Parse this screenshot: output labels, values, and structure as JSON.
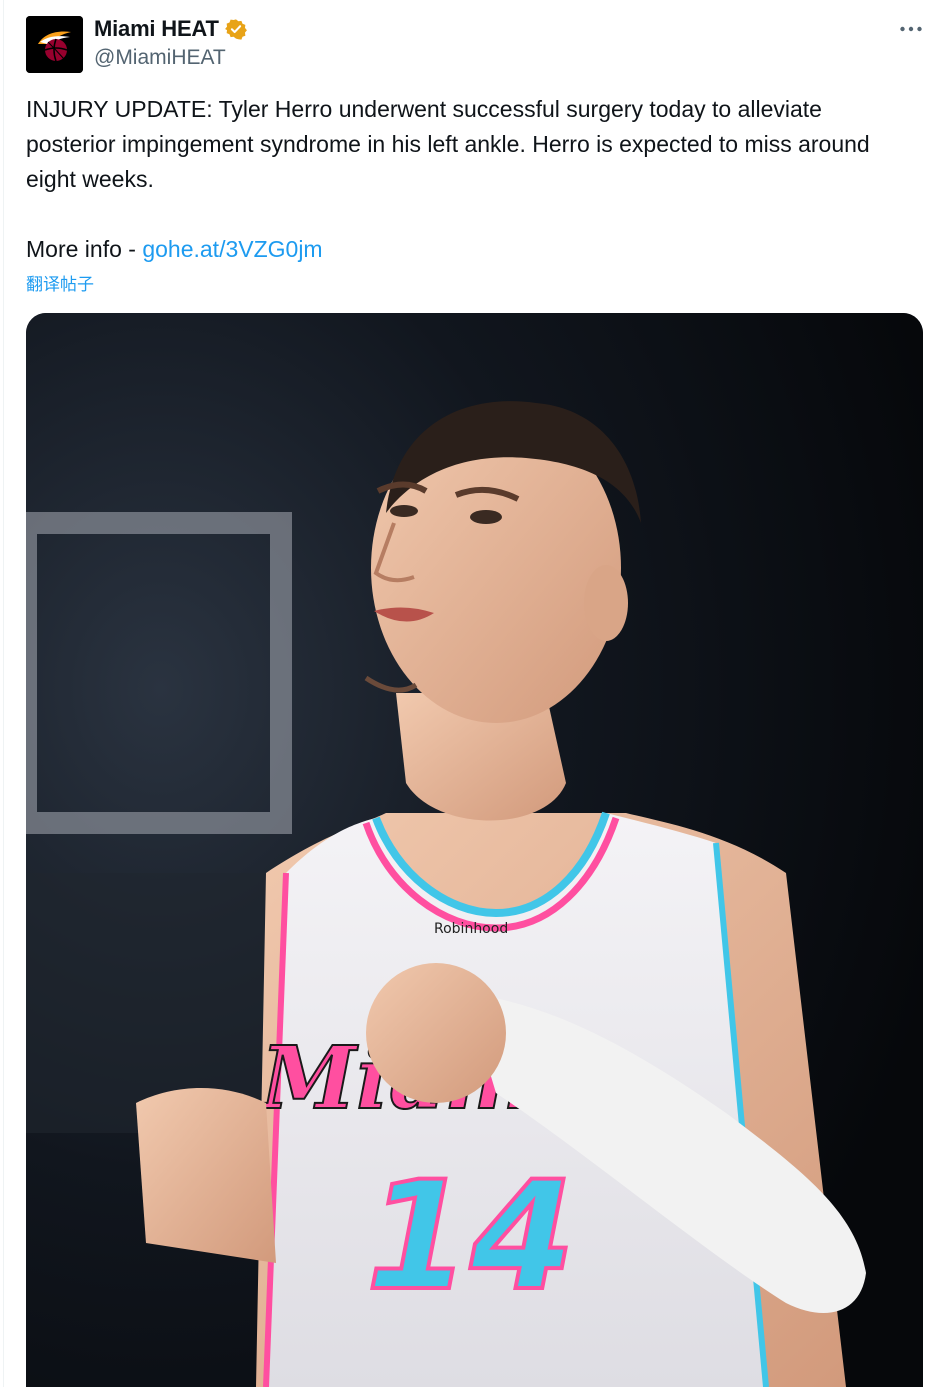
{
  "author": {
    "display_name": "Miami HEAT",
    "handle": "@MiamiHEAT",
    "verified_badge": "gold-verified-check",
    "avatar_icon": "heat-flaming-ball-logo"
  },
  "tweet": {
    "text_main": "INJURY UPDATE: Tyler Herro underwent successful surgery today to alleviate posterior impingement syndrome in his left ankle. Herro is expected to miss around eight weeks.",
    "more_info_prefix": "More info - ",
    "link_text": "gohe.at/3VZG0jm",
    "translate_label": "翻译帖子"
  },
  "media": {
    "jersey_text": "Miami",
    "jersey_number": "14",
    "sponsor_text": "Robinhood"
  },
  "icons": {
    "more": "more-horizontal-icon"
  },
  "colors": {
    "text": "#0f1419",
    "secondary": "#536471",
    "link": "#1d9bf0",
    "badge": "#e8a317",
    "jersey_pink": "#ff4fa0",
    "jersey_blue": "#41c6e8"
  }
}
